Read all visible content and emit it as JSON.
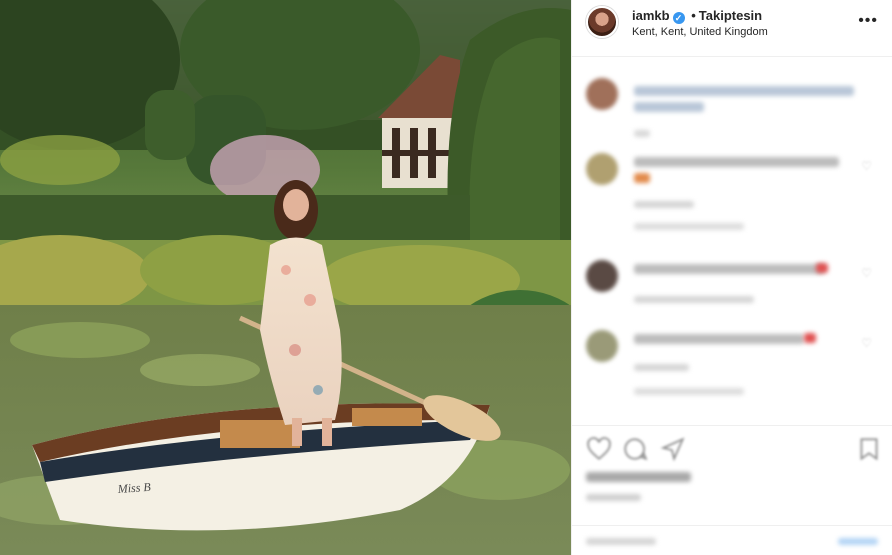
{
  "post": {
    "username": "iamkb",
    "follow_label": "Takiptesin",
    "location": "Kent, Kent, United Kingdom",
    "more_label": "•••",
    "verified_mark": "✓",
    "separator": "•"
  },
  "photo": {
    "boat_name": "Miss B"
  },
  "icons": {
    "heart": "♡",
    "comment": "comment-icon",
    "share": "share-icon",
    "save": "bookmark-icon"
  },
  "colors": {
    "verified": "#3897f0",
    "border": "#efefef",
    "text": "#262626"
  }
}
